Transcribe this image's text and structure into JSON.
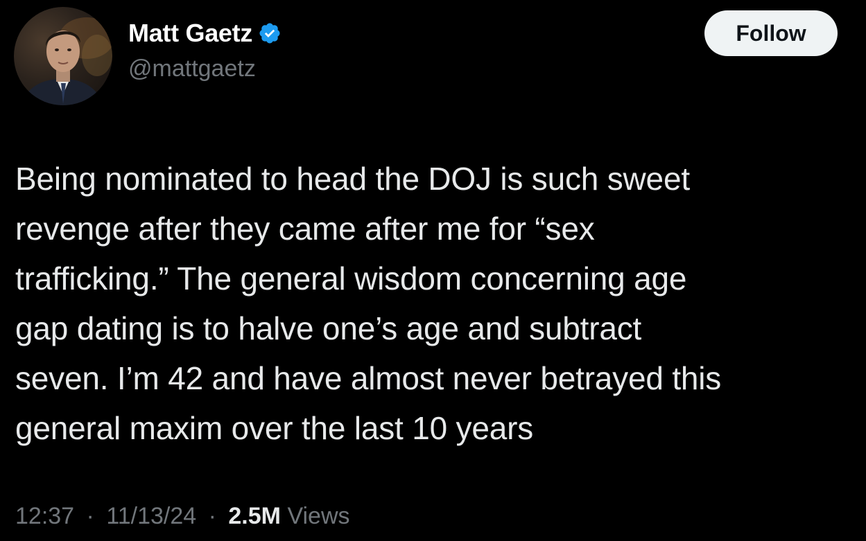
{
  "author": {
    "display_name": "Matt Gaetz",
    "handle": "@mattgaetz",
    "verified_icon": "verified-badge-icon",
    "avatar_icon": "profile-photo"
  },
  "follow_button": {
    "label": "Follow"
  },
  "tweet": {
    "lines": [
      "Being nominated to head the DOJ is such sweet",
      "revenge after they came after me for “sex",
      "trafficking.” The general wisdom concerning age",
      "gap dating is to halve one’s age and subtract",
      "seven. I’m 42 and have almost never betrayed this",
      "general maxim over the last 10 years"
    ]
  },
  "meta": {
    "time": "12:37",
    "separator": "·",
    "date": "11/13/24",
    "views_count": "2.5M",
    "views_label": "Views"
  },
  "colors": {
    "background": "#000000",
    "primary_text": "#e7e9ea",
    "secondary_text": "#71767b",
    "verified_blue": "#1d9bf0",
    "follow_bg": "#eff3f4"
  }
}
